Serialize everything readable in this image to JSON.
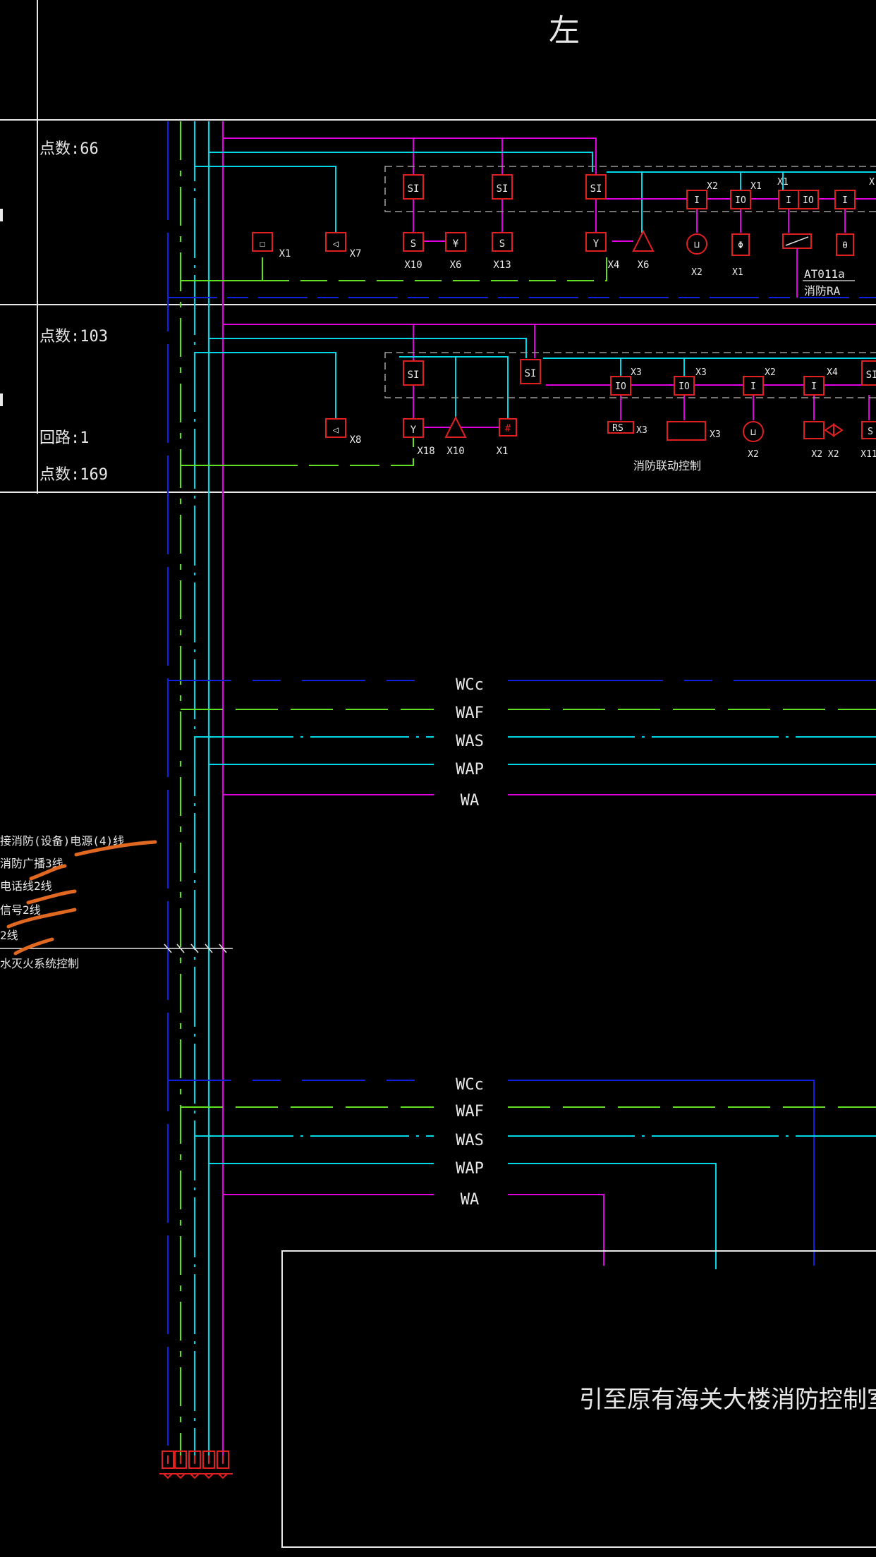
{
  "header": {
    "title": "左"
  },
  "rows": [
    {
      "label_a": "点数:66",
      "label_b": "",
      "label_c": ""
    },
    {
      "label_a": "点数:103",
      "label_b": "回路:1",
      "label_c": "点数:169"
    }
  ],
  "row1": {
    "modules": [
      "SI",
      "SI",
      "SI"
    ],
    "bottom_devices": [
      {
        "code": "X10",
        "symbol": "S"
      },
      {
        "code": "X6",
        "symbol": "¥"
      },
      {
        "code": "X13",
        "symbol": "S"
      },
      {
        "code": "X4",
        "symbol": "Y"
      },
      {
        "code": "X6",
        "symbol": "⚠"
      }
    ],
    "left_devices": [
      {
        "code": "X1",
        "symbol": "☐"
      },
      {
        "code": "X7",
        "symbol": "◁"
      }
    ],
    "io_modules": [
      {
        "code": "X2",
        "symbol": "I"
      },
      {
        "code": "X1",
        "symbol": "IO"
      },
      {
        "code": "X1",
        "symbol": "I"
      },
      {
        "code": "",
        "symbol": "IO"
      },
      {
        "code": "X",
        "symbol": "I"
      }
    ],
    "io_devices": [
      {
        "code": "X2",
        "symbol": "⊔"
      },
      {
        "code": "X1",
        "symbol": "Φ"
      },
      {
        "code": "",
        "symbol": "⁄"
      },
      {
        "code": "",
        "symbol": "θ"
      }
    ],
    "note": "AT011a",
    "note2": "消防RA"
  },
  "row2": {
    "modules": [
      "SI",
      "SI",
      "SI"
    ],
    "bottom_devices": [
      {
        "code": "X18",
        "symbol": "Y"
      },
      {
        "code": "X10",
        "symbol": "⚠"
      },
      {
        "code": "X1",
        "symbol": "#"
      }
    ],
    "left_devices": [
      {
        "code": "X8",
        "symbol": "◁"
      }
    ],
    "io_modules": [
      {
        "code": "X3",
        "symbol": "IO"
      },
      {
        "code": "X3",
        "symbol": "IO"
      },
      {
        "code": "X2",
        "symbol": "I"
      },
      {
        "code": "X4",
        "symbol": "I"
      }
    ],
    "io_devices": [
      {
        "code": "X3",
        "symbol": "RS"
      },
      {
        "code": "X3",
        "symbol": ""
      },
      {
        "code": "X2",
        "symbol": "⊔"
      },
      {
        "code": "X2 X2",
        "symbol": "⁄⋈"
      },
      {
        "code": "X11",
        "symbol": "S"
      }
    ],
    "note": "消防联动控制"
  },
  "buses_upper": [
    "WCc",
    "WAF",
    "WAS",
    "WAP",
    "WA"
  ],
  "buses_lower": [
    "WCc",
    "WAF",
    "WAS",
    "WAP",
    "WA"
  ],
  "riser_notes": [
    "接消防(设备)电源(4)线",
    "消防广播3线",
    "电话线2线",
    "信号2线",
    "2线",
    "水灭火系统控制"
  ],
  "terminal_label": "引至原有海关大楼消防控制室",
  "colors": {
    "magenta": "#e000e0",
    "cyan": "#00d8e8",
    "green": "#60e020",
    "blue": "#1020e0",
    "red": "#e02020",
    "orange": "#e06820",
    "white": "#e8e8e8",
    "gray": "#9a9a9a"
  }
}
